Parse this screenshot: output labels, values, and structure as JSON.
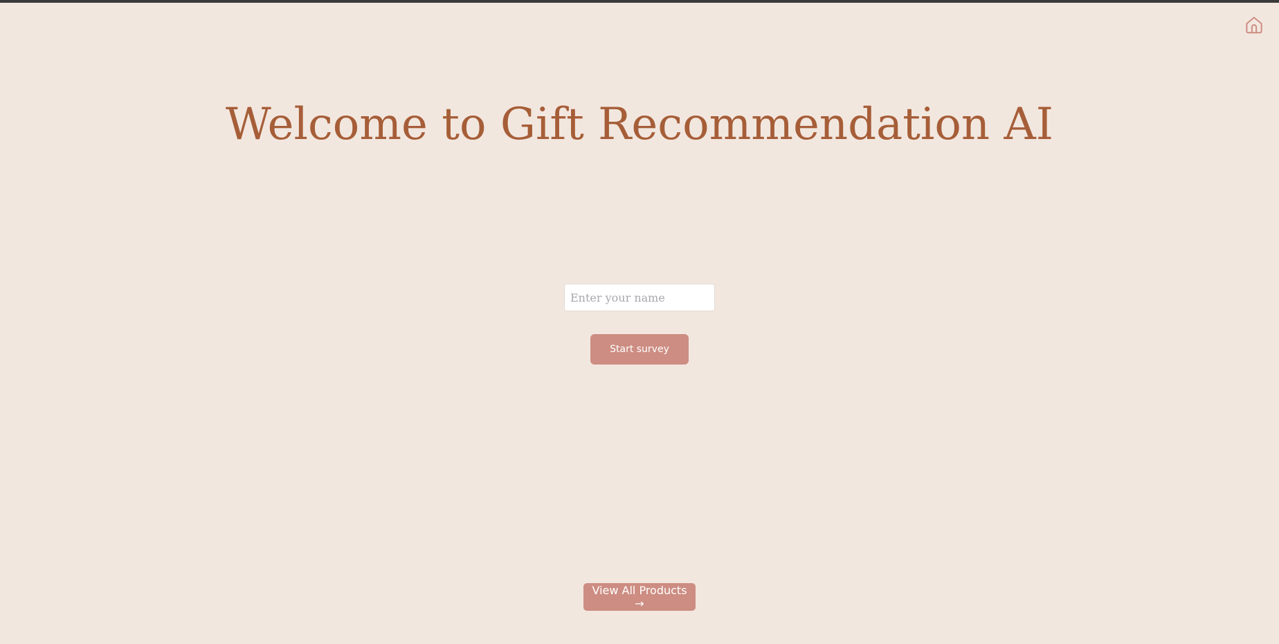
{
  "colors": {
    "background": "#f2e7df",
    "title": "#a65e38",
    "accent": "#cd8d82",
    "button_text": "#ffffff",
    "input_background": "#ffffff",
    "placeholder": "#a7a7ad",
    "top_bar": "#3a3a3a"
  },
  "header": {
    "home_icon": "home-icon"
  },
  "main": {
    "title": "Welcome to Gift Recommendation AI",
    "name_input": {
      "value": "",
      "placeholder": "Enter your name"
    },
    "start_button_label": "Start survey"
  },
  "footer": {
    "view_products_label": "View All Products →"
  }
}
